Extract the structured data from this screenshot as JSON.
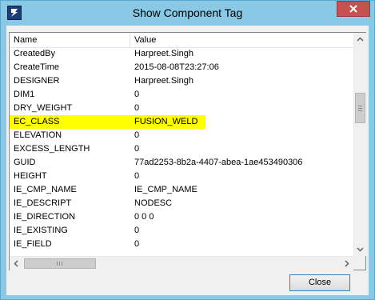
{
  "window": {
    "title": "Show Component Tag",
    "icons": {
      "app": "app-logo-icon",
      "close": "close-icon"
    }
  },
  "list": {
    "columns": {
      "name": "Name",
      "value": "Value"
    },
    "rows": [
      {
        "name": "CreatedBy",
        "value": "Harpreet.Singh",
        "highlight": false
      },
      {
        "name": "CreateTime",
        "value": "2015-08-08T23:27:06",
        "highlight": false
      },
      {
        "name": "DESIGNER",
        "value": "Harpreet.Singh",
        "highlight": false
      },
      {
        "name": "DIM1",
        "value": "0",
        "highlight": false
      },
      {
        "name": "DRY_WEIGHT",
        "value": "0",
        "highlight": false
      },
      {
        "name": "EC_CLASS",
        "value": "FUSION_WELD",
        "highlight": true
      },
      {
        "name": "ELEVATION",
        "value": "0",
        "highlight": false
      },
      {
        "name": "EXCESS_LENGTH",
        "value": "0",
        "highlight": false
      },
      {
        "name": "GUID",
        "value": "77ad2253-8b2a-4407-abea-1ae453490306",
        "highlight": false
      },
      {
        "name": "HEIGHT",
        "value": "0",
        "highlight": false
      },
      {
        "name": "IE_CMP_NAME",
        "value": "IE_CMP_NAME",
        "highlight": false
      },
      {
        "name": "IE_DESCRIPT",
        "value": "NODESC",
        "highlight": false
      },
      {
        "name": "IE_DIRECTION",
        "value": "0 0 0",
        "highlight": false
      },
      {
        "name": "IE_EXISTING",
        "value": "0",
        "highlight": false
      },
      {
        "name": "IE_FIELD",
        "value": "0",
        "highlight": false
      }
    ],
    "highlight_color": "#ffff00"
  },
  "footer": {
    "close_label": "Close"
  },
  "colors": {
    "titlebar": "#89c9e6",
    "close_x": "#c75050",
    "button_border": "#3c7fb1"
  }
}
